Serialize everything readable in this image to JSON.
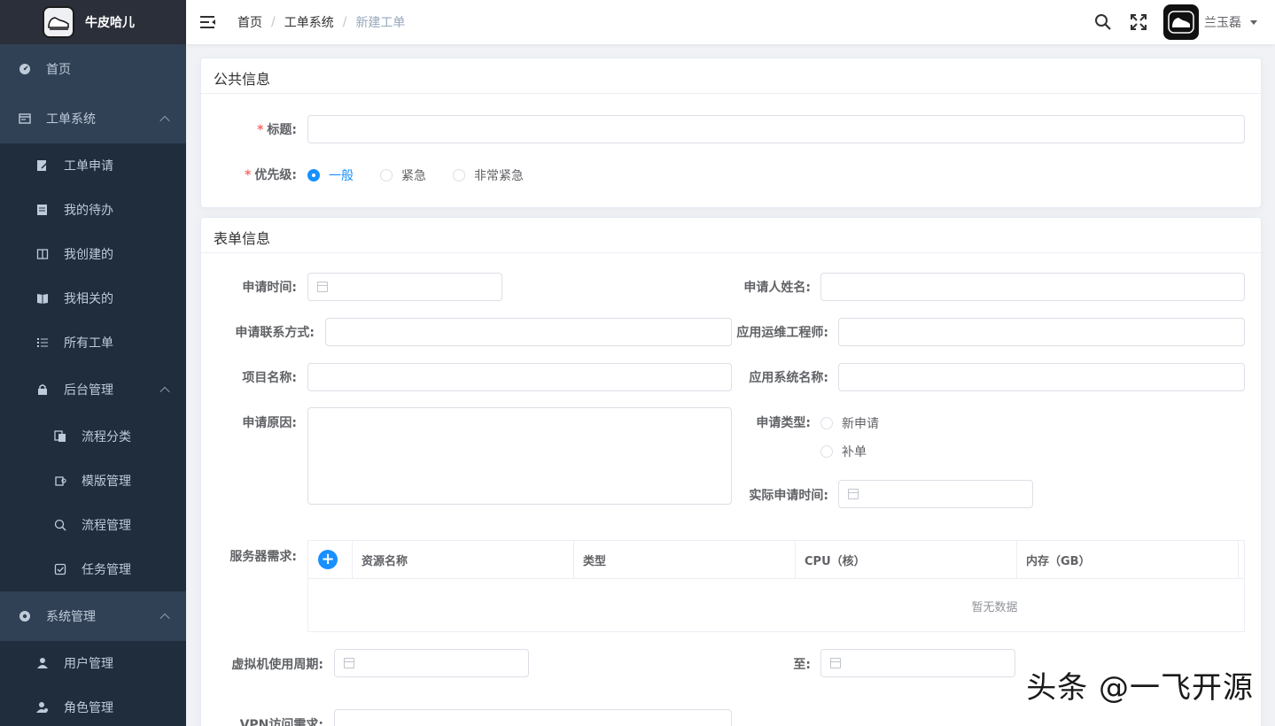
{
  "app": {
    "name": "牛皮哈儿"
  },
  "sidebar": {
    "items": [
      {
        "label": "首页",
        "icon": "dashboard-icon"
      },
      {
        "label": "工单系统",
        "icon": "ticket-icon",
        "expanded": true
      },
      {
        "label": "工单申请",
        "icon": "edit-icon"
      },
      {
        "label": "我的待办",
        "icon": "todo-icon"
      },
      {
        "label": "我创建的",
        "icon": "columns-icon"
      },
      {
        "label": "我相关的",
        "icon": "book-icon"
      },
      {
        "label": "所有工单",
        "icon": "list-icon"
      },
      {
        "label": "后台管理",
        "icon": "lock-icon",
        "expanded": true
      },
      {
        "label": "流程分类",
        "icon": "copy-icon"
      },
      {
        "label": "模版管理",
        "icon": "template-icon"
      },
      {
        "label": "流程管理",
        "icon": "flow-icon"
      },
      {
        "label": "任务管理",
        "icon": "task-icon"
      },
      {
        "label": "系统管理",
        "icon": "system-icon",
        "expanded": true
      },
      {
        "label": "用户管理",
        "icon": "user-icon"
      },
      {
        "label": "角色管理",
        "icon": "role-icon"
      }
    ]
  },
  "breadcrumb": [
    "首页",
    "工单系统",
    "新建工单"
  ],
  "user": {
    "name": "兰玉磊"
  },
  "public_info": {
    "title": "公共信息",
    "title_label": "标题:",
    "priority_label": "优先级:",
    "priority_options": [
      "一般",
      "紧急",
      "非常紧急"
    ],
    "priority_selected": "一般"
  },
  "form_info": {
    "title": "表单信息",
    "apply_time_label": "申请时间:",
    "applicant_name_label": "申请人姓名:",
    "contact_label": "申请联系方式:",
    "ops_engineer_label": "应用运维工程师:",
    "project_name_label": "项目名称:",
    "app_system_label": "应用系统名称:",
    "reason_label": "申请原因:",
    "apply_type_label": "申请类型:",
    "apply_type_options": [
      "新申请",
      "补单"
    ],
    "actual_time_label": "实际申请时间:",
    "server_label": "服务器需求:",
    "server_table": {
      "columns": [
        "资源名称",
        "类型",
        "CPU（核）",
        "内存（GB）"
      ],
      "empty_text": "暂无数据"
    },
    "vm_period_label": "虚拟机使用周期:",
    "to_label": "至:",
    "vpn_label": "VPN访问需求:"
  },
  "watermark": "头条 @一飞开源"
}
